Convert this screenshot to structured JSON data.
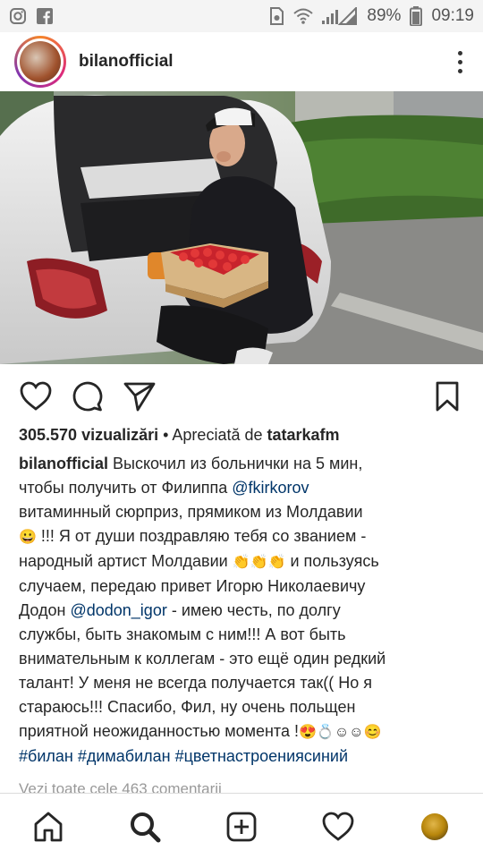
{
  "status_bar": {
    "left_icons": [
      "instagram-icon",
      "facebook-icon"
    ],
    "right_icons": [
      "sim-icon",
      "wifi-icon",
      "signal-icon",
      "battery-icon"
    ],
    "battery": "89%",
    "time": "09:19"
  },
  "post": {
    "username": "bilanofficial",
    "views_count": "305.570 vizualizări",
    "liked_by_prefix": " • Apreciată de ",
    "liked_by_user": "tatarkafm",
    "caption_author": "bilanofficial",
    "caption": {
      "l1": " Выскочил из больнички на 5 мин,",
      "l2a": "чтобы получить от Филиппа ",
      "l2_mention": "@fkirkorov",
      "l3": "витаминный сюрприз, прямиком из Молдавии",
      "l4_emoji": "😀",
      "l4": " !!! Я от души поздравляю тебя со званием -",
      "l5a": "народный артист Молдавии ",
      "l5_emoji": "👏👏👏",
      "l5b": " и пользуясь",
      "l6": "случаем, передаю привет Игорю Николаевичу",
      "l7a": "Додон ",
      "l7_mention": "@dodon_igor",
      "l7b": " - имею честь, по долгу",
      "l8": "службы, быть знакомым с ним!!! А вот быть",
      "l9": "внимательным к коллегам - это ещё один редкий",
      "l10": "талант! У меня не всегда получается так(( Но я",
      "l11": "стараюсь!!! Спасибо, Фил, ну очень польщен",
      "l12a": "приятной неожиданностью момента !",
      "l12_emoji": "😍💍☺☺😊",
      "hashtags": "#билан #димабилан #цветнастроениясиний"
    },
    "comments_link": "Vezi toate cele 463 comentarii"
  },
  "actions": {
    "like": "heart-icon",
    "comment": "comment-icon",
    "share": "send-icon",
    "save": "bookmark-icon"
  },
  "bottom_nav": {
    "items": [
      "home-icon",
      "search-icon",
      "add-icon",
      "activity-icon",
      "profile-avatar"
    ]
  },
  "colors": {
    "link": "#003569",
    "text": "#262626",
    "muted": "#999999",
    "status_bar_bg": "#f4f4f4"
  }
}
